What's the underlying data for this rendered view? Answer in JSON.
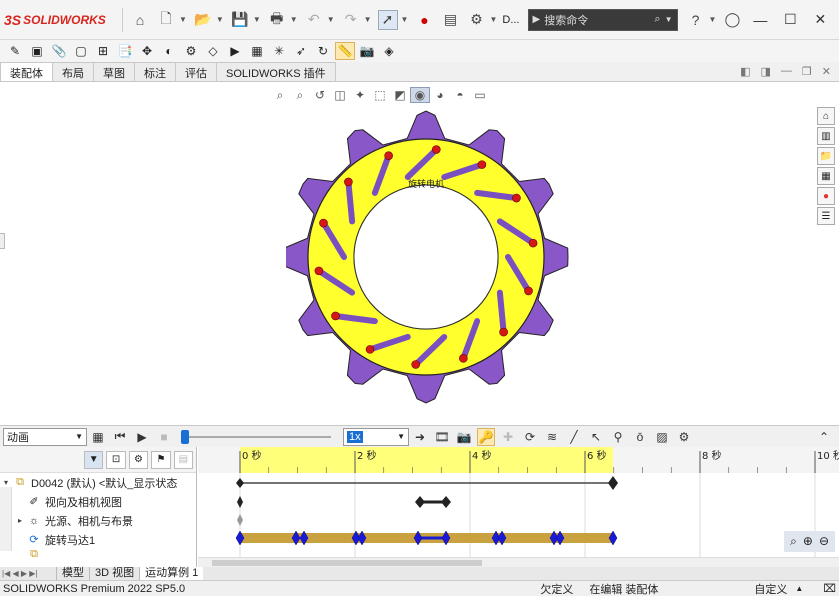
{
  "app": {
    "name": "SOLIDWORKS",
    "ds_mark": "3S"
  },
  "titlebar": {
    "doc_menu_label": "D...",
    "search_placeholder": "搜索命令",
    "icons": [
      "home-icon",
      "new-file-icon",
      "open-icon",
      "save-icon",
      "print-icon",
      "undo-icon",
      "redo-icon",
      "select-pointer-icon",
      "traffic-light-icon",
      "file-properties-icon",
      "settings-icon"
    ]
  },
  "tabs": [
    "装配体",
    "布局",
    "草图",
    "标注",
    "评估",
    "SOLIDWORKS 插件"
  ],
  "active_tab": "装配体",
  "viewport": {
    "part_label": "旋转电机",
    "colors": {
      "ring": "#ffff2e",
      "teeth": "#8a57c8",
      "slots": "#7a4fc0",
      "dots": "#d41818"
    }
  },
  "motion": {
    "study_type": "动画",
    "playback_speed": "1x",
    "time_labels": [
      "0 秒",
      "2 秒",
      "4 秒",
      "6 秒",
      "8 秒",
      "10 秒"
    ],
    "tree": [
      {
        "label": "D0042 (默认) <默认_显示状态",
        "indent": 0,
        "twist": "▾"
      },
      {
        "label": "视向及相机视图",
        "indent": 1,
        "twist": ""
      },
      {
        "label": "光源、相机与布景",
        "indent": 1,
        "twist": "▸"
      },
      {
        "label": "旋转马达1",
        "indent": 1,
        "twist": ""
      }
    ]
  },
  "bottom_tabs": [
    "模型",
    "3D 视图",
    "运动算例 1"
  ],
  "active_bottom_tab": "运动算例 1",
  "status": {
    "product": "SOLIDWORKS Premium 2022 SP5.0",
    "state": "欠定义",
    "mode": "在编辑 装配体",
    "units": "自定义"
  }
}
